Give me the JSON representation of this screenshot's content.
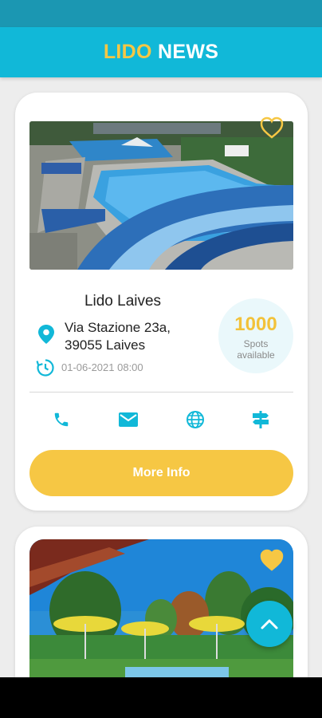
{
  "header": {
    "title_part1": "LIDO",
    "title_part2": "NEWS"
  },
  "cards": [
    {
      "name": "Lido Laives",
      "address_line1": "Via Stazione 23a,",
      "address_line2": "39055 Laives",
      "date": "01-06-2021 08:00",
      "spots_count": "1000",
      "spots_label_line1": "Spots",
      "spots_label_line2": "available",
      "favorite": false,
      "more_info_label": "More Info",
      "actions": [
        "phone-icon",
        "mail-icon",
        "globe-icon",
        "signpost-icon"
      ]
    },
    {
      "favorite": true
    }
  ],
  "colors": {
    "accent_blue": "#11b8d8",
    "status_bar": "#1b97b2",
    "accent_yellow": "#f6c744"
  },
  "icons": {
    "scroll_top": "chevron-up-icon"
  }
}
